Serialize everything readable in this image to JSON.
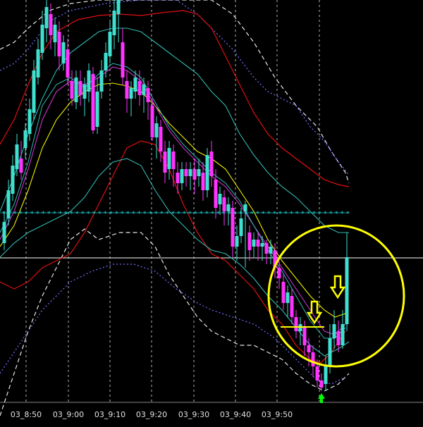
{
  "chart_data": {
    "type": "candlestick",
    "grid": true,
    "x_tick_labels": [
      "03_8:50",
      "03_9:00",
      "03_9:10",
      "03_9:20",
      "03_9:30",
      "03_9:40",
      "03_9:50"
    ],
    "colors": {
      "background": "#000000",
      "bull": "#40e0d0",
      "bear": "#ff33ff",
      "upper_band": "#e01010",
      "mid_band": "#30b8b0",
      "dashed_band": "#e8e8e8",
      "dotted_band": "#7070ff",
      "ma_yellow": "#f0f000",
      "ma_magenta": "#cc33cc",
      "crosshair": "#ffffff",
      "star_line": "#20e0e0",
      "annotation": "#ffff00",
      "signal_arrow": "#00ff00"
    },
    "annotations": {
      "circle": true,
      "down_arrows": 2,
      "up_arrow": true
    }
  }
}
